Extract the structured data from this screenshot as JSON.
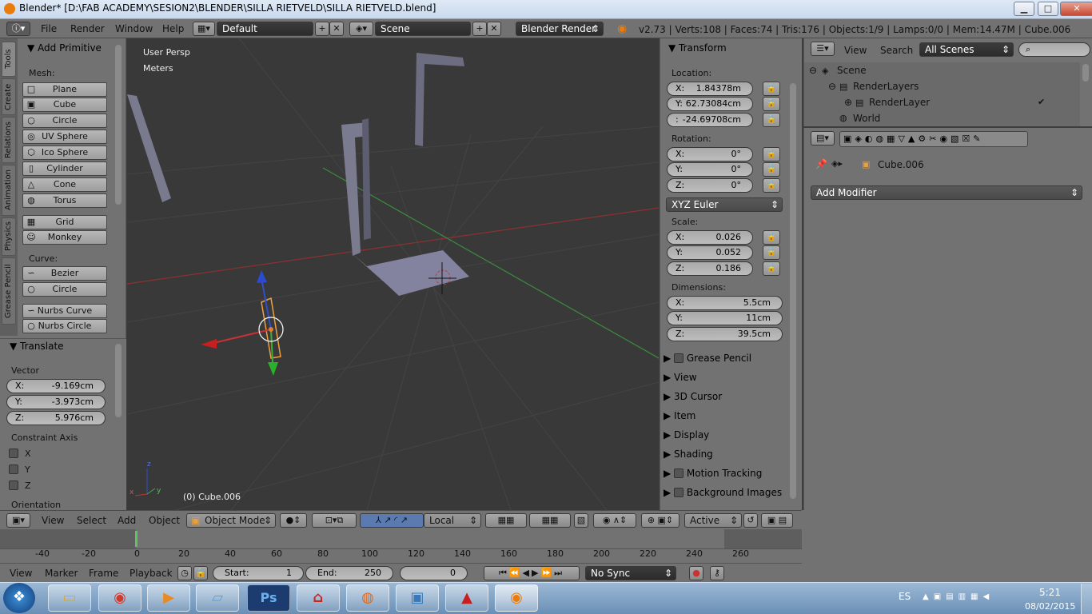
{
  "window": {
    "title": "Blender* [D:\\FAB ACADEMY\\SESION2\\BLENDER\\SILLA RIETVELD\\SILLA RIETVELD.blend]",
    "minimize": "▁",
    "maximize": "□",
    "close": "✕"
  },
  "info_header": {
    "menus": [
      "File",
      "Render",
      "Window",
      "Help"
    ],
    "layout": "Default",
    "scene": "Scene",
    "engine": "Blender Render",
    "stats": "v2.73 | Verts:108 | Faces:74 | Tris:176 | Objects:1/9 | Lamps:0/0 | Mem:14.47M | Cube.006"
  },
  "tool_tabs": [
    "Tools",
    "Create",
    "Relations",
    "Animation",
    "Physics",
    "Grease Pencil"
  ],
  "add_primitive": {
    "title": "Add Primitive",
    "mesh_label": "Mesh:",
    "mesh": [
      {
        "label": "Plane",
        "icon": "plane-icon",
        "glyph": "□"
      },
      {
        "label": "Cube",
        "icon": "cube-icon",
        "glyph": "▣"
      },
      {
        "label": "Circle",
        "icon": "circle-icon",
        "glyph": "○"
      },
      {
        "label": "UV Sphere",
        "icon": "uv-sphere-icon",
        "glyph": "◎"
      },
      {
        "label": "Ico Sphere",
        "icon": "ico-sphere-icon",
        "glyph": "⬡"
      },
      {
        "label": "Cylinder",
        "icon": "cylinder-icon",
        "glyph": "▯"
      },
      {
        "label": "Cone",
        "icon": "cone-icon",
        "glyph": "△"
      },
      {
        "label": "Torus",
        "icon": "torus-icon",
        "glyph": "◍"
      },
      {
        "label": "Grid",
        "icon": "grid-icon",
        "glyph": "▦"
      },
      {
        "label": "Monkey",
        "icon": "monkey-icon",
        "glyph": "☺"
      }
    ],
    "curve_label": "Curve:",
    "curve": [
      {
        "label": "Bezier",
        "icon": "bezier-icon",
        "glyph": "∽"
      },
      {
        "label": "Circle",
        "icon": "curve-circle-icon",
        "glyph": "○"
      },
      {
        "label": "Nurbs Curve",
        "icon": "nurbs-curve-icon",
        "glyph": "∽"
      },
      {
        "label": "Nurbs Circle",
        "icon": "nurbs-circle-icon",
        "glyph": "○"
      }
    ]
  },
  "translate": {
    "title": "Translate",
    "vector_label": "Vector",
    "x": {
      "label": "X:",
      "value": "-9.169cm"
    },
    "y": {
      "label": "Y:",
      "value": "-3.973cm"
    },
    "z": {
      "label": "Z:",
      "value": "5.976cm"
    },
    "constraint_label": "Constraint Axis",
    "axes": [
      "X",
      "Y",
      "Z"
    ],
    "orientation_label": "Orientation"
  },
  "viewport": {
    "view_name": "User Persp",
    "units": "Meters",
    "object_label": "(0) Cube.006",
    "axis_x": "x",
    "axis_y": "y",
    "axis_z": "z"
  },
  "transform": {
    "title": "Transform",
    "location_label": "Location:",
    "location": [
      {
        "label": "X:",
        "value": "1.84378m"
      },
      {
        "label": "Y:",
        "value": "62.73084cm"
      },
      {
        "label": ":",
        "value": "-24.69708cm"
      }
    ],
    "rotation_label": "Rotation:",
    "rotation": [
      {
        "label": "X:",
        "value": "0°"
      },
      {
        "label": "Y:",
        "value": "0°"
      },
      {
        "label": "Z:",
        "value": "0°"
      }
    ],
    "rotation_mode": "XYZ Euler",
    "scale_label": "Scale:",
    "scale": [
      {
        "label": "X:",
        "value": "0.026"
      },
      {
        "label": "Y:",
        "value": "0.052"
      },
      {
        "label": "Z:",
        "value": "0.186"
      }
    ],
    "dimensions_label": "Dimensions:",
    "dimensions": [
      {
        "label": "X:",
        "value": "5.5cm"
      },
      {
        "label": "Y:",
        "value": "11cm"
      },
      {
        "label": "Z:",
        "value": "39.5cm"
      }
    ]
  },
  "npanel_sections": [
    {
      "label": "Grease Pencil",
      "checkbox": true
    },
    {
      "label": "View",
      "checkbox": false
    },
    {
      "label": "3D Cursor",
      "checkbox": false
    },
    {
      "label": "Item",
      "checkbox": false
    },
    {
      "label": "Display",
      "checkbox": false
    },
    {
      "label": "Shading",
      "checkbox": false
    },
    {
      "label": "Motion Tracking",
      "checkbox": true
    },
    {
      "label": "Background Images",
      "checkbox": true
    }
  ],
  "outliner": {
    "view": "View",
    "search": "Search",
    "filter": "All Scenes",
    "tree": [
      {
        "label": "Scene",
        "indent": 0
      },
      {
        "label": "RenderLayers",
        "indent": 1
      },
      {
        "label": "RenderLayer",
        "indent": 2
      },
      {
        "label": "World",
        "indent": 1
      }
    ]
  },
  "properties": {
    "object_name": "Cube.006",
    "add_modifier": "Add Modifier"
  },
  "viewport_header": {
    "menus": [
      "View",
      "Select",
      "Add",
      "Object"
    ],
    "mode": "Object Mode",
    "orientation": "Local",
    "pivot": "Active"
  },
  "timeline": {
    "ticks": [
      "-40",
      "-20",
      "0",
      "20",
      "40",
      "60",
      "80",
      "100",
      "120",
      "140",
      "160",
      "180",
      "200",
      "220",
      "240",
      "260"
    ],
    "menus": [
      "View",
      "Marker",
      "Frame",
      "Playback"
    ],
    "start_label": "Start:",
    "start": "1",
    "end_label": "End:",
    "end": "250",
    "current": "0",
    "sync": "No Sync"
  },
  "taskbar": {
    "lang": "ES",
    "time": "5:21",
    "date": "08/02/2015",
    "apps": [
      "explorer",
      "chrome",
      "media-player",
      "notepad",
      "photoshop",
      "acrobat",
      "firefox",
      "photos",
      "autocad",
      "blender"
    ],
    "ps_label": "Ps"
  },
  "colors": {
    "accent_red": "#c83232",
    "axis_green": "#3fae3f",
    "selection_orange": "#f0a040"
  }
}
